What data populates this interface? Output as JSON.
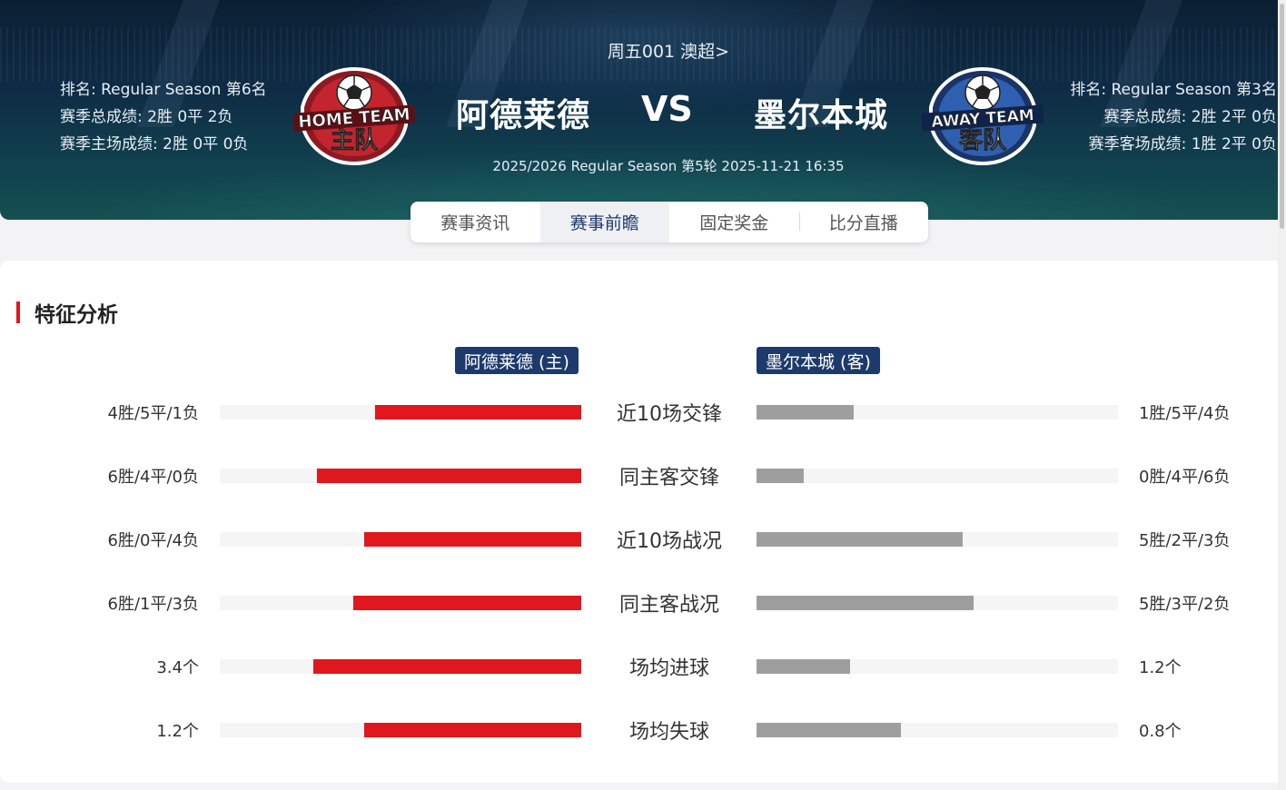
{
  "header": {
    "league_link": "周五001 澳超>",
    "home_team": "阿德莱德",
    "away_team": "墨尔本城",
    "vs": "VS",
    "season_line": "2025/2026 Regular Season 第5轮 2025-11-21 16:35",
    "home_info": {
      "rank": "排名: Regular Season 第6名",
      "season_record": "赛季总成绩: 2胜 0平 2负",
      "home_record": "赛季主场成绩: 2胜 0平 0负"
    },
    "away_info": {
      "rank": "排名: Regular Season 第3名",
      "season_record": "赛季总成绩: 2胜 2平 0负",
      "away_record": "赛季客场成绩: 1胜 2平 0负"
    },
    "home_badge": {
      "top_text": "HOME TEAM",
      "main_text": "主队",
      "icon": "soccer-ball-icon"
    },
    "away_badge": {
      "top_text": "AWAY TEAM",
      "main_text": "客队",
      "icon": "soccer-ball-icon"
    }
  },
  "tabs": [
    {
      "label": "赛事资讯",
      "active": false
    },
    {
      "label": "赛事前瞻",
      "active": true
    },
    {
      "label": "固定奖金",
      "active": false
    },
    {
      "label": "比分直播",
      "active": false
    }
  ],
  "analysis": {
    "title": "特征分析",
    "home_tag": "阿德莱德 (主)",
    "away_tag": "墨尔本城 (客)",
    "rows": [
      {
        "label": "近10场交锋",
        "home_value": "4胜/5平/1负",
        "away_value": "1胜/5平/4负",
        "home_ratio": 0.57,
        "away_ratio": 0.27
      },
      {
        "label": "同主客交锋",
        "home_value": "6胜/4平/0负",
        "away_value": "0胜/4平/6负",
        "home_ratio": 0.73,
        "away_ratio": 0.13
      },
      {
        "label": "近10场战况",
        "home_value": "6胜/0平/4负",
        "away_value": "5胜/2平/3负",
        "home_ratio": 0.6,
        "away_ratio": 0.57
      },
      {
        "label": "同主客战况",
        "home_value": "6胜/1平/3负",
        "away_value": "5胜/3平/2负",
        "home_ratio": 0.63,
        "away_ratio": 0.6
      },
      {
        "label": "场均进球",
        "home_value": "3.4个",
        "away_value": "1.2个",
        "home_ratio": 0.74,
        "away_ratio": 0.26
      },
      {
        "label": "场均失球",
        "home_value": "1.2个",
        "away_value": "0.8个",
        "home_ratio": 0.6,
        "away_ratio": 0.4
      }
    ]
  },
  "colors": {
    "accent_red": "#e1171e",
    "navy": "#1c3a6b",
    "bar_grey": "#9e9e9e"
  }
}
